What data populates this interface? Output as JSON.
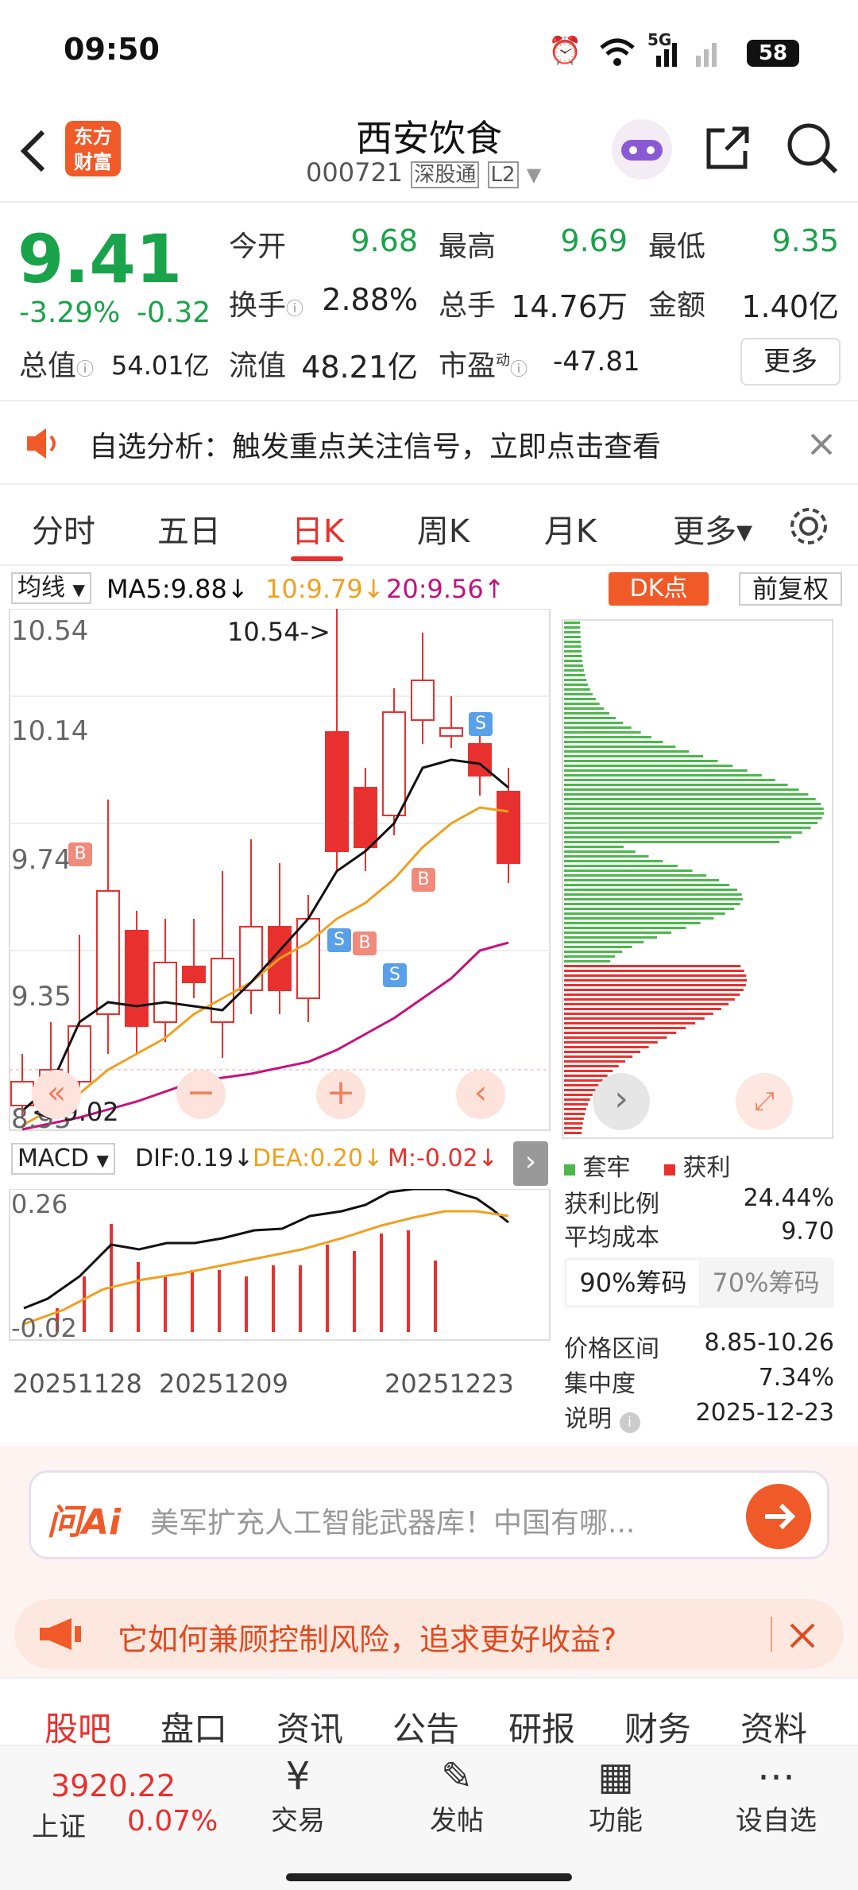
{
  "status": {
    "time": "09:50",
    "battery": "58",
    "network": "5G"
  },
  "header": {
    "title": "西安饮食",
    "code": "000721",
    "market_tag": "深股通",
    "level_tag": "L2",
    "brand_line1": "东方",
    "brand_line2": "财富"
  },
  "quote": {
    "price": "9.41",
    "change_pct": "-3.29%",
    "change": "-0.32",
    "open_label": "今开",
    "open": "9.68",
    "high_label": "最高",
    "high": "9.69",
    "low_label": "最低",
    "low": "9.35",
    "turnover_label": "换手",
    "turnover": "2.88%",
    "volume_label": "总手",
    "volume": "14.76万",
    "amount_label": "金额",
    "amount": "1.40亿",
    "mktcap_label": "总值",
    "mktcap": "54.01亿",
    "float_label": "流值",
    "float": "48.21亿",
    "pe_label": "市盈",
    "pe_sup": "动",
    "pe": "-47.81",
    "more": "更多"
  },
  "notice": {
    "text": "自选分析：触发重点关注信号，立即点击查看"
  },
  "tabs": [
    "分时",
    "五日",
    "日K",
    "周K",
    "月K",
    "更多▾"
  ],
  "active_tab": "日K",
  "kline": {
    "ma_btn": "均线",
    "ma5": "MA5:9.88↓",
    "ma10": "10:9.79↓",
    "ma20": "20:9.56↑",
    "dk_btn": "DK点",
    "fq_btn": "前复权",
    "y_labels": [
      "10.54",
      "10.14",
      "9.74",
      "9.35",
      "8.95"
    ],
    "max_mark": "10.54->",
    "min_mark": "<-9.02",
    "colors": {
      "up": "#e8312f",
      "down": "#e8312f",
      "ma5": "#111111",
      "ma10": "#f0a020",
      "ma20": "#c8107c"
    }
  },
  "macd": {
    "btn": "MACD",
    "dif": "DIF:0.19↓",
    "dea": "DEA:0.20↓",
    "m": "M:-0.02↓",
    "y_top": "0.26",
    "y_bot": "-0.02",
    "dates": [
      "20251128",
      "20251209",
      "20251223"
    ]
  },
  "chips": {
    "legend_trapped": "套牢",
    "legend_profit": "获利",
    "rows": [
      {
        "k": "获利比例",
        "v": "24.44%"
      },
      {
        "k": "平均成本",
        "v": "9.70"
      }
    ],
    "tab90": "90%筹码",
    "tab70": "70%筹码",
    "rows2": [
      {
        "k": "价格区间",
        "v": "8.85-10.26"
      },
      {
        "k": "集中度",
        "v": "7.34%"
      },
      {
        "k": "说明",
        "v": "2025-12-23"
      }
    ]
  },
  "ai": {
    "logo": "问Ai",
    "placeholder": "美军扩充人工智能武器库！中国有哪..."
  },
  "promo": {
    "text": "它如何兼顾控制风险，追求更好收益?"
  },
  "subtabs": [
    "股吧",
    "盘口",
    "资讯",
    "公告",
    "研报",
    "财务",
    "资料"
  ],
  "bottom": {
    "index_value": "3920.22",
    "index_name": "上证",
    "index_change": "0.07%",
    "items": [
      "交易",
      "发帖",
      "功能",
      "设自选"
    ]
  }
}
